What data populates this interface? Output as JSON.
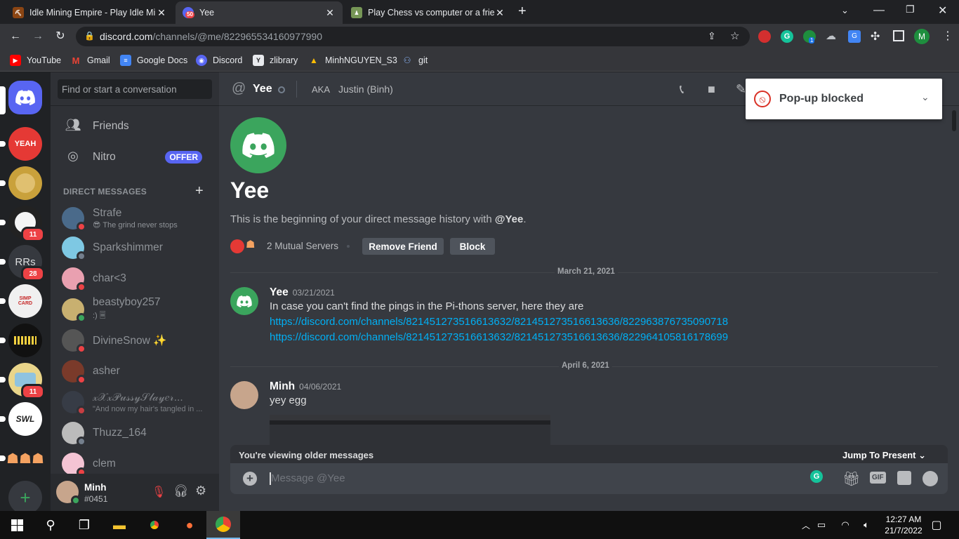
{
  "browser": {
    "tabs": [
      {
        "title": "Idle Mining Empire - Play Idle Mi",
        "active": false
      },
      {
        "title": "Yee",
        "badge": "50",
        "active": true
      },
      {
        "title": "Play Chess vs computer or a frien",
        "active": false
      }
    ],
    "new_tab": "+",
    "url_host": "discord.com",
    "url_path": "/channels/@me/822965534160977990",
    "profile_initial": "M",
    "ext_badge": "1",
    "bookmarks": [
      "YouTube",
      "Gmail",
      "Google Docs",
      "Discord",
      "zlibrary",
      "MinhNGUYEN_S3",
      "git"
    ],
    "popup_blocked": "Pop-up blocked"
  },
  "guilds": [
    {
      "label": "YEAH",
      "color": "#e53935"
    },
    {
      "label": "",
      "color": "#c9a13b"
    },
    {
      "label": "",
      "color": "#222222",
      "badge": "11"
    },
    {
      "label": "RRs",
      "color": "#36393f",
      "badge": "28"
    },
    {
      "label": "SIMP CARD",
      "color": "#f0f0f0"
    },
    {
      "label": "",
      "color": "#111111"
    },
    {
      "label": "",
      "color": "#e9d58a",
      "badge": "11"
    },
    {
      "label": "SWL",
      "color": "#ffffff"
    },
    {
      "label": "",
      "color": "#202225"
    }
  ],
  "sidebar": {
    "search_placeholder": "Find or start a conversation",
    "friends": "Friends",
    "nitro": "Nitro",
    "offer": "OFFER",
    "dm_header": "DIRECT MESSAGES",
    "dms": [
      {
        "name": "Strafe",
        "sub": "😎 The grind never stops",
        "status": "dnd",
        "color": "#4a6a8a"
      },
      {
        "name": "Sparkshimmer",
        "sub": "",
        "status": "off",
        "color": "#7ec8e3"
      },
      {
        "name": "char<3",
        "sub": "",
        "status": "dnd",
        "color": "#e9a0b0"
      },
      {
        "name": "beastyboy257",
        "sub": ":) 🗏",
        "status": "on",
        "color": "#c8b070"
      },
      {
        "name": "DivineSnow ✨",
        "sub": "",
        "status": "dnd",
        "color": "#555555"
      },
      {
        "name": "asher",
        "sub": "",
        "status": "dnd",
        "color": "#7a3a2a"
      },
      {
        "name": "𝓍𝒳𝓍𝒫𝓊𝓈𝓈𝓎𝒮𝓁𝒶𝓎𝑒𝓇...",
        "sub": "\"And now my hair's tangled in ...",
        "status": "dnd",
        "color": "#3a3f4a"
      },
      {
        "name": "Thuzz_164",
        "sub": "",
        "status": "off",
        "color": "#bbbbbb"
      },
      {
        "name": "clem",
        "sub": "",
        "status": "dnd",
        "color": "#f4c4d4"
      }
    ],
    "user": {
      "name": "Minh",
      "tag": "#0451"
    }
  },
  "chat": {
    "channel_name": "Yee",
    "aka_label": "AKA",
    "aka_value": "Justin (Binh)",
    "welcome_title": "Yee",
    "welcome_text_prefix": "This is the beginning of your direct message history with ",
    "welcome_handle": "@Yee",
    "welcome_text_suffix": ".",
    "mutual_servers": "2 Mutual Servers",
    "remove_friend": "Remove Friend",
    "block": "Block",
    "date1": "March 21, 2021",
    "msg1": {
      "author": "Yee",
      "timestamp": "03/21/2021",
      "text": "In case you can't find the pings in the Pi-thons server, here they are",
      "link1": "https://discord.com/channels/821451273516613632/821451273516613636/822963876735090718",
      "link2": "https://discord.com/channels/821451273516613632/821451273516613636/822964105816178699"
    },
    "date2": "April 6, 2021",
    "msg2": {
      "author": "Minh",
      "timestamp": "04/06/2021",
      "text": "yey egg"
    },
    "older_bar": "You're viewing older messages",
    "jump_present": "Jump To Present",
    "composer_placeholder": "Message @Yee",
    "gif_label": "GIF"
  },
  "taskbar": {
    "time": "12:27 AM",
    "date": "21/7/2022"
  }
}
